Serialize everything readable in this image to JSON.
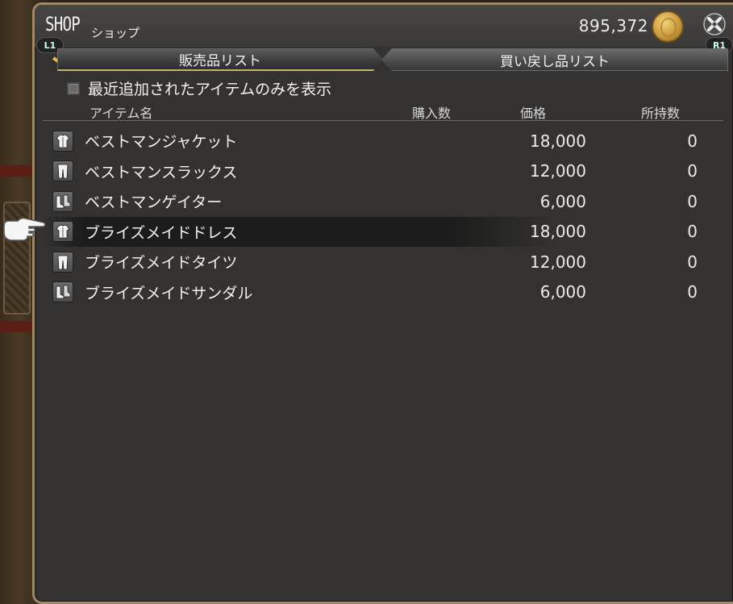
{
  "window": {
    "title": "SHOP",
    "subtitle": "ショップ",
    "gil": "895,372",
    "badge_left": "L1",
    "badge_right": "R1"
  },
  "tabs": [
    {
      "label": "販売品リスト",
      "active": true
    },
    {
      "label": "買い戻し品リスト",
      "active": false
    }
  ],
  "filter": {
    "label": "最近追加されたアイテムのみを表示",
    "checked": false
  },
  "table": {
    "headers": {
      "name": "アイテム名",
      "buy": "購入数",
      "price": "価格",
      "owned": "所持数"
    },
    "rows": [
      {
        "icon": "body-armor-icon",
        "name": "ベストマンジャケット",
        "price": "18,000",
        "owned": "0"
      },
      {
        "icon": "legs-icon",
        "name": "ベストマンスラックス",
        "price": "12,000",
        "owned": "0"
      },
      {
        "icon": "feet-icon",
        "name": "ベストマンゲイター",
        "price": "6,000",
        "owned": "0"
      },
      {
        "icon": "body-armor-icon",
        "name": "ブライズメイドドレス",
        "price": "18,000",
        "owned": "0"
      },
      {
        "icon": "legs-icon",
        "name": "ブライズメイドタイツ",
        "price": "12,000",
        "owned": "0"
      },
      {
        "icon": "feet-icon",
        "name": "ブライズメイドサンダル",
        "price": "6,000",
        "owned": "0"
      }
    ],
    "selected_index": 3
  },
  "colors": {
    "panel": "#333231",
    "frame": "#a08a66",
    "tab_accent": "#c9b070"
  }
}
